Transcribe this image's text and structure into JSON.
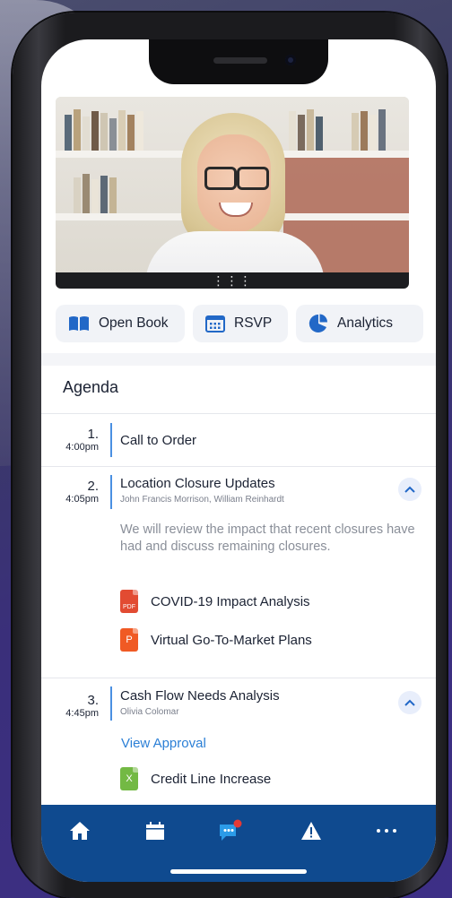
{
  "actions": [
    {
      "label": "Open Book",
      "icon": "book-icon"
    },
    {
      "label": "RSVP",
      "icon": "calendar-grid-icon"
    },
    {
      "label": "Analytics",
      "icon": "pie-chart-icon"
    }
  ],
  "agenda": {
    "title": "Agenda",
    "items": [
      {
        "number": "1.",
        "time": "4:00pm",
        "title": "Call to Order"
      },
      {
        "number": "2.",
        "time": "4:05pm",
        "title": "Location Closure Updates",
        "presenters": "John Francis Morrison, William Reinhardt",
        "description": "We will review the impact that recent closures have had and discuss remaining closures.",
        "documents": [
          {
            "name": "COVID-19 Impact Analysis",
            "type": "PDF"
          },
          {
            "name": "Virtual Go-To-Market Plans",
            "type": "P"
          }
        ]
      },
      {
        "number": "3.",
        "time": "4:45pm",
        "title": "Cash Flow Needs Analysis",
        "presenters": "Olivia Colomar",
        "link": "View Approval",
        "documents": [
          {
            "name": "Credit Line Increase",
            "type": "X"
          }
        ]
      }
    ]
  },
  "tabs": [
    "home-icon",
    "calendar-icon",
    "chat-icon",
    "alert-icon",
    "more-icon"
  ],
  "colors": {
    "tabbar": "#0f4a8f",
    "accent": "#2b7fd6",
    "notification": "#e53935"
  }
}
